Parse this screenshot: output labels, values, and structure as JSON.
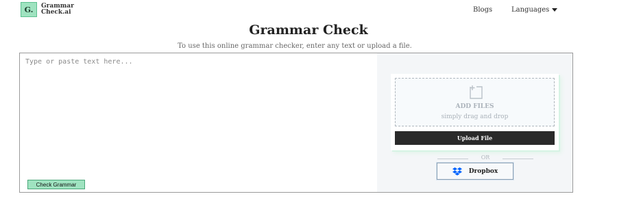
{
  "header": {
    "logo_mark": "G.",
    "logo_line1": "Grammar",
    "logo_line2": "Check.ai",
    "nav_blogs": "Blogs",
    "nav_languages": "Languages"
  },
  "page": {
    "title": "Grammar Check",
    "subtitle": "To use this online grammar checker, enter any text or upload a file."
  },
  "editor": {
    "placeholder": "Type or paste text here...",
    "value": "",
    "check_button": "Check Grammar"
  },
  "upload": {
    "add_files": "ADD FILES",
    "drag_text": "simply drag and drop",
    "upload_button": "Upload File",
    "or_text": "OR",
    "dropbox_button": "Dropbox"
  },
  "icons": {
    "file_add": "file-plus-icon",
    "dropbox": "dropbox-icon",
    "caret": "caret-down-icon"
  },
  "colors": {
    "accent_green": "#9fe3c0",
    "dark_button": "#2a2a2a",
    "dropbox_blue": "#0061fe"
  }
}
